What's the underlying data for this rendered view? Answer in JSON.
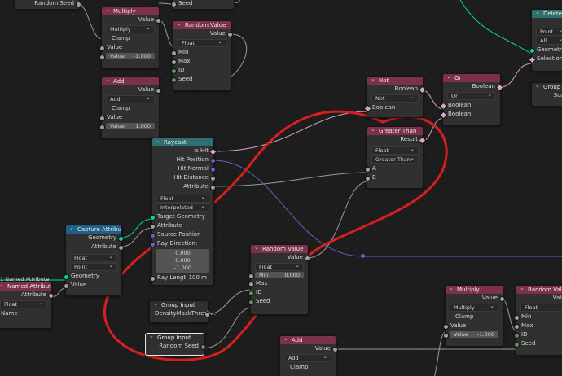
{
  "colors": {
    "annotation": "#d61f1f",
    "geometry_link": "#00d6a3",
    "vector_link": "#6363c7",
    "float_link": "#9a9a9a",
    "bool_link": "#cfa0c0"
  },
  "nodes": {
    "random_seed_top": {
      "label": "Random Seed"
    },
    "seed_top": {
      "label": "Seed"
    },
    "multiply1": {
      "title": "Multiply",
      "out_value": "Value",
      "op": "Multiply",
      "clamp": "Clamp",
      "in_value": "Value",
      "field_label": "Value",
      "field_value": "-1.000"
    },
    "random1": {
      "title": "Random Value",
      "out_value": "Value",
      "type": "Float",
      "min": "Min",
      "max": "Max",
      "id": "ID",
      "seed": "Seed"
    },
    "add1": {
      "title": "Add",
      "out_value": "Value",
      "op": "Add",
      "clamp": "Clamp",
      "in_value": "Value",
      "field_label": "Value",
      "field_value": "1.000"
    },
    "not": {
      "title": "Not",
      "out_bool": "Boolean",
      "op": "Not",
      "in_bool": "Boolean"
    },
    "or": {
      "title": "Or",
      "out_bool": "Boolean",
      "op": "Or",
      "in_bool_a": "Boolean",
      "in_bool_b": "Boolean"
    },
    "delete_geo": {
      "title": "Delete Ge",
      "op1": "Point",
      "op2": "All",
      "geometry": "Geometry",
      "selection": "Selection"
    },
    "group_in_right": {
      "title": "Group In",
      "text": "Scat"
    },
    "greater": {
      "title": "Greater Than",
      "out_result": "Result",
      "type": "Float",
      "op": "Greater Than",
      "a": "A",
      "b": "B"
    },
    "raycast": {
      "title": "Raycast",
      "is_hit": "Is Hit",
      "hit_position": "Hit Position",
      "hit_normal": "Hit Normal",
      "hit_distance": "Hit Distance",
      "attribute_out": "Attribute",
      "type": "Float",
      "mapping": "Interpolated",
      "target_geometry": "Target Geometry",
      "attribute_in": "Attribute",
      "source_position": "Source Position",
      "ray_direction": "Ray Direction:",
      "dir_x": "0.000",
      "dir_y": "0.000",
      "dir_z": "-1.000",
      "ray_length_label": "Ray Lengt",
      "ray_length_value": "100 m"
    },
    "capture": {
      "title": "Capture Attribute",
      "out_geometry": "Geometry",
      "out_attribute": "Attribute",
      "type": "Float",
      "domain": "Point",
      "in_geometry": "Geometry",
      "in_value": "Value"
    },
    "named_attr": {
      "title": "Named Attribute",
      "header_label": "1 Named Attribute",
      "out_attribute": "Attribute",
      "type": "Float",
      "name": "Name"
    },
    "random2": {
      "title": "Random Value",
      "out_value": "Value",
      "type": "Float",
      "min_label": "Min",
      "min_value": "0.000",
      "max": "Max",
      "id": "ID",
      "seed": "Seed"
    },
    "group_input1": {
      "title": "Group Input",
      "output": "DensityMaskThresh..."
    },
    "group_input2": {
      "title": "Group Input",
      "output": "Random Seed"
    },
    "add2": {
      "title": "Add",
      "out_value": "Value",
      "op": "Add",
      "clamp": "Clamp"
    },
    "multiply2": {
      "title": "Multiply",
      "out_value": "Value",
      "op": "Multiply",
      "clamp": "Clamp",
      "in_value": "Value",
      "field_label": "Value",
      "field_value": "-1.000"
    },
    "random3": {
      "title": "Random Value",
      "out_value": "Value",
      "type": "Float",
      "min": "Min",
      "max": "Max",
      "id": "ID",
      "seed": "Seed"
    }
  }
}
